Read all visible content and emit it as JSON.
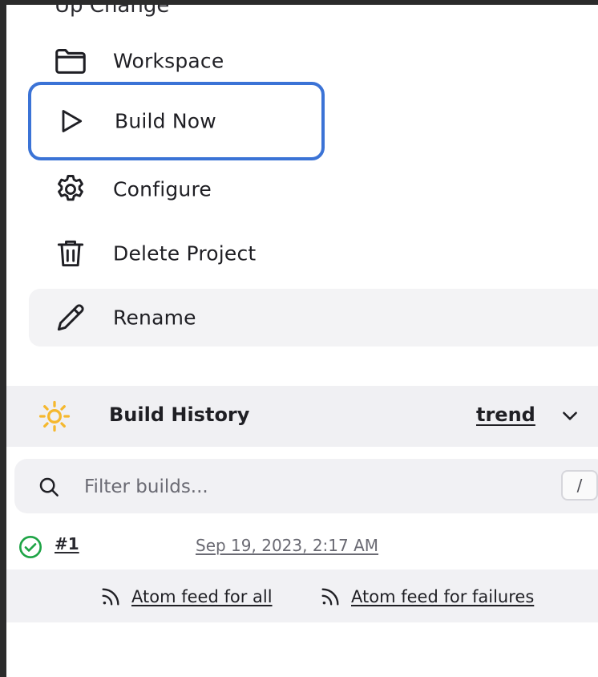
{
  "sidebar": {
    "partial_top_label": "Up  Change",
    "items": [
      {
        "label": "Workspace",
        "icon": "folder-icon"
      },
      {
        "label": "Build Now",
        "icon": "play-icon"
      },
      {
        "label": "Configure",
        "icon": "gear-icon"
      },
      {
        "label": "Delete Project",
        "icon": "trash-icon"
      },
      {
        "label": "Rename",
        "icon": "pencil-icon"
      }
    ],
    "highlight_color": "#3b73d6"
  },
  "build_history": {
    "title": "Build History",
    "trend_label": "trend",
    "filter": {
      "placeholder": "Filter builds...",
      "shortcut": "/"
    },
    "builds": [
      {
        "number": "#1",
        "date": "Sep 19, 2023, 2:17 AM",
        "status": "success"
      }
    ],
    "feeds": {
      "all": "Atom feed for all",
      "failures": "Atom feed for failures"
    },
    "sun_color": "#f5b82e",
    "success_color": "#1ea446"
  }
}
